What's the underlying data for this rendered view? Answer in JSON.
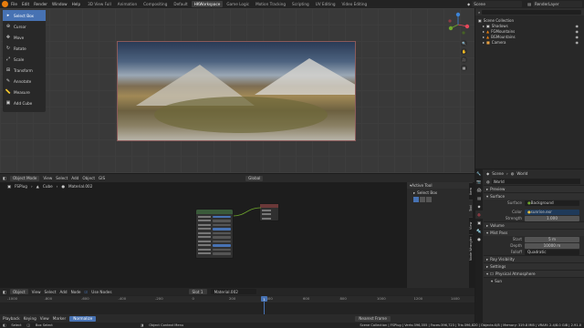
{
  "topbar": {
    "menus": [
      "File",
      "Edit",
      "Render",
      "Window",
      "Help"
    ],
    "workspaces": [
      "3D View Full",
      "Animation",
      "Compositing",
      "Default",
      "HKWorkspace",
      "Game Logic",
      "Motion Tracking",
      "Scripting",
      "UV Editing",
      "Video Editing"
    ],
    "active_workspace": "HKWorkspace",
    "scene": "Scene",
    "view_layer": "RenderLayer"
  },
  "toolbar": {
    "tools": [
      {
        "label": "Select Box",
        "icon": "select-box-icon",
        "active": true
      },
      {
        "label": "Cursor",
        "icon": "cursor-icon"
      },
      {
        "label": "Move",
        "icon": "move-icon"
      },
      {
        "label": "Rotate",
        "icon": "rotate-icon"
      },
      {
        "label": "Scale",
        "icon": "scale-icon"
      },
      {
        "label": "Transform",
        "icon": "transform-icon"
      },
      {
        "label": "Annotate",
        "icon": "annotate-icon"
      },
      {
        "label": "Measure",
        "icon": "measure-icon"
      },
      {
        "label": "Add Cube",
        "icon": "add-cube-icon"
      }
    ]
  },
  "outliner": {
    "title": "Scene Collection",
    "items": [
      "Shadows",
      "FGMountains",
      "BGMountains",
      "Camera"
    ]
  },
  "node_editor": {
    "mode": "Object Mode",
    "menus": [
      "View",
      "Select",
      "Add",
      "Object",
      "GIS"
    ],
    "transform": "Global",
    "breadcrumb": [
      "FSPlug",
      "Cube",
      "Material.002"
    ],
    "side_panel_title": "Active Tool",
    "side_tool": "Select Box",
    "side_tabs": [
      "Item",
      "Tool",
      "View",
      "Node Wrangler"
    ],
    "bottom": {
      "type": "Object",
      "menus": [
        "View",
        "Select",
        "Add",
        "Node"
      ],
      "use_nodes": "Use Nodes",
      "slot": "Slot 1",
      "material": "Material.002"
    }
  },
  "properties": {
    "path": [
      "Scene",
      "World"
    ],
    "world_name": "World",
    "sections": {
      "preview": "Preview",
      "surface": "Surface",
      "volume": "Volume",
      "mist": "Mist Pass",
      "ray": "Ray Visibility",
      "settings": "Settings",
      "atmos": "Physical Atmosphere",
      "sun": "Sun"
    },
    "surface": {
      "label": "Surface",
      "value": "Background"
    },
    "color": {
      "label": "Color",
      "value": "sunrise.exr"
    },
    "strength": {
      "label": "Strength",
      "value": "1.000"
    },
    "mist": {
      "start": {
        "label": "Start",
        "value": "5 m"
      },
      "depth": {
        "label": "Depth",
        "value": "10000 m"
      },
      "falloff": {
        "label": "Falloff",
        "value": "Quadratic"
      }
    }
  },
  "timeline": {
    "ticks": [
      "-1000",
      "-800",
      "-600",
      "-400",
      "-200",
      "0",
      "200",
      "400",
      "600",
      "800",
      "1000",
      "1200",
      "1400"
    ],
    "current_frame": "1",
    "menus": [
      "Playback",
      "Keying",
      "View",
      "Marker"
    ],
    "mode": "Normalize",
    "nearest_frame": "Nearest Frame"
  },
  "status": {
    "items": [
      "Select",
      "Box Select",
      "Object Context Menu"
    ],
    "right": "Scene Collection | FSPlug | Verts:396,355 | Faces:396,723 | Tris:396,820 | Objects:0/8 | Memory: 319.8 MiB | VRAM: 2.4/8.0 GiB | 2.91.0"
  },
  "colors": {
    "accent": "#4772b3",
    "orange": "#e87d0d"
  }
}
